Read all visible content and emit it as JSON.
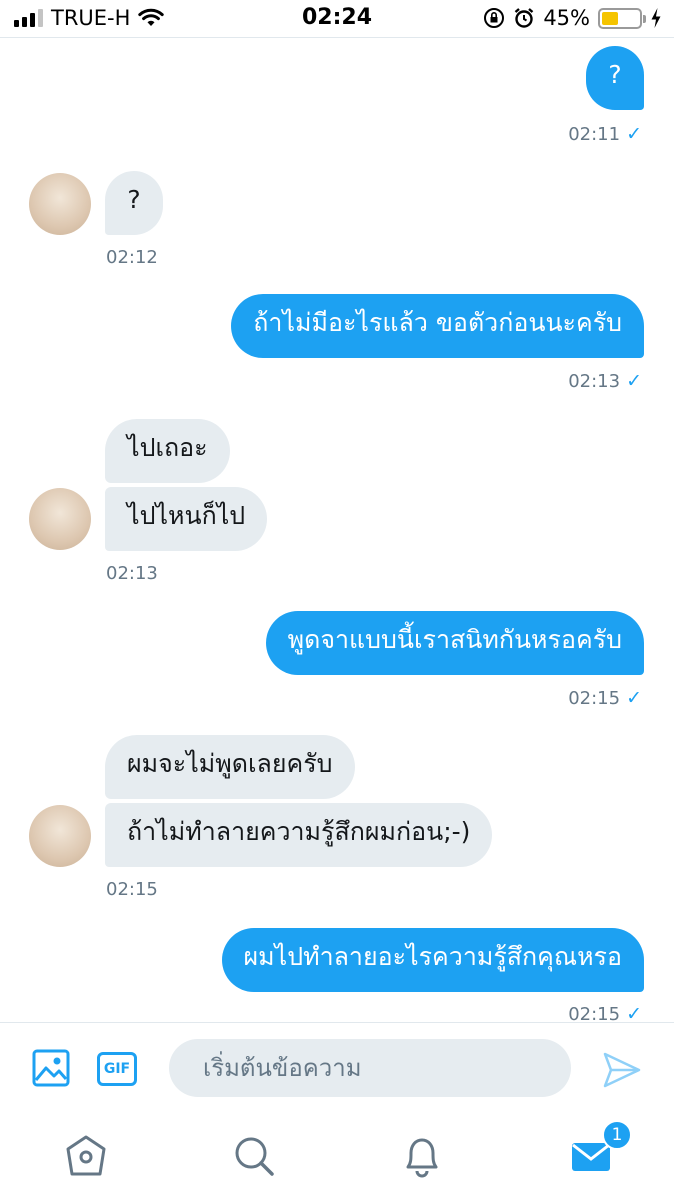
{
  "status_bar": {
    "carrier": "TRUE-H",
    "time": "02:24",
    "battery_percent": "45%",
    "battery_level": 0.45,
    "icons": [
      "signal-icon",
      "wifi-icon",
      "orientation-lock-icon",
      "alarm-icon",
      "battery-icon",
      "charging-icon"
    ]
  },
  "messages": [
    {
      "side": "out",
      "text": "?",
      "time": "02:11"
    },
    {
      "side": "in",
      "text": "?",
      "time": "02:12"
    },
    {
      "side": "out",
      "text": "ถ้าไม่มีอะไรแล้ว ขอตัวก่อนนะครับ",
      "time": "02:13"
    },
    {
      "side": "in",
      "texts": [
        "ไปเถอะ",
        "ไปไหนก็ไป"
      ],
      "time": "02:13"
    },
    {
      "side": "out",
      "text": "พูดจาแบบนี้เราสนิทกันหรอครับ",
      "time": "02:15"
    },
    {
      "side": "in",
      "texts": [
        "ผมจะไม่พูดเลยครับ",
        "ถ้าไม่ทำลายความรู้สึกผมก่อน;-)"
      ],
      "time": "02:15"
    },
    {
      "side": "out",
      "text": "ผมไปทำลายอะไรความรู้สึกคุณหรอ",
      "time": "02:15"
    }
  ],
  "compose": {
    "gif_label": "GIF",
    "placeholder": "เริ่มต้นข้อความ",
    "value": ""
  },
  "tabbar": {
    "messages_badge": "1"
  },
  "colors": {
    "accent": "#1da1f2",
    "incoming_bubble": "#e6ecf0",
    "timestamp": "#657786"
  }
}
